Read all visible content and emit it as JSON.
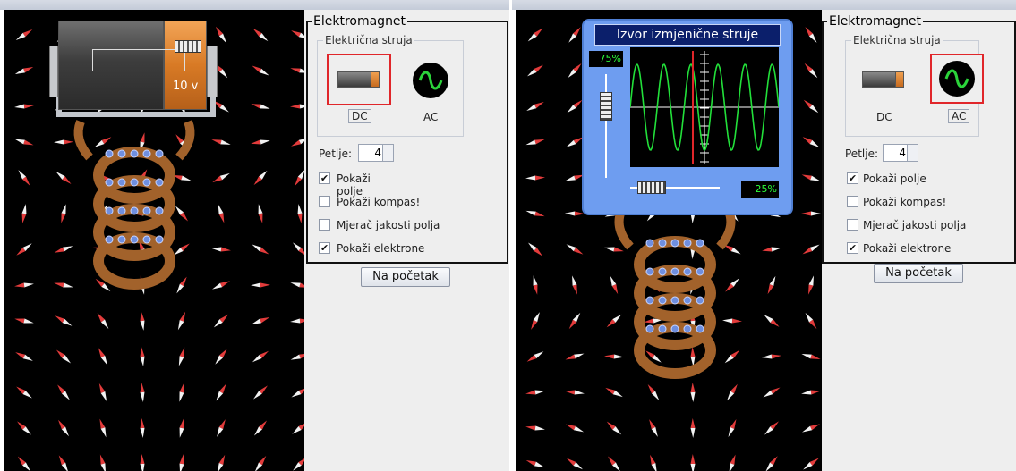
{
  "left": {
    "group_title": "Elektromagnet",
    "source_title": "Električna struja",
    "dc_label": "DC",
    "ac_label": "AC",
    "battery_voltage": "10 v",
    "loops_label": "Petlje:",
    "loops_value": "4",
    "checkboxes": [
      {
        "label": "Pokaži polje",
        "checked": true
      },
      {
        "label": "Pokaži kompas!",
        "checked": false
      },
      {
        "label": "Mjerač jakosti polja",
        "checked": false
      },
      {
        "label": "Pokaži elektrone",
        "checked": true
      }
    ],
    "reset_label": "Na početak"
  },
  "right": {
    "group_title": "Elektromagnet",
    "source_title": "Električna struja",
    "dc_label": "DC",
    "ac_label": "AC",
    "ac_source_title": "Izvor izmjenične struje",
    "amplitude_pct": "75%",
    "frequency_pct": "25%",
    "loops_label": "Petlje:",
    "loops_value": "4",
    "checkboxes": [
      {
        "label": "Pokaži polje",
        "checked": true
      },
      {
        "label": "Pokaži kompas!",
        "checked": false
      },
      {
        "label": "Mjerač jakosti polja",
        "checked": false
      },
      {
        "label": "Pokaži elektrone",
        "checked": true
      }
    ],
    "reset_label": "Na početak"
  },
  "colors": {
    "selected_border": "#e0262a",
    "coil": "#a2622b",
    "electron": "#6f8fe0",
    "wave": "#22e03a"
  }
}
